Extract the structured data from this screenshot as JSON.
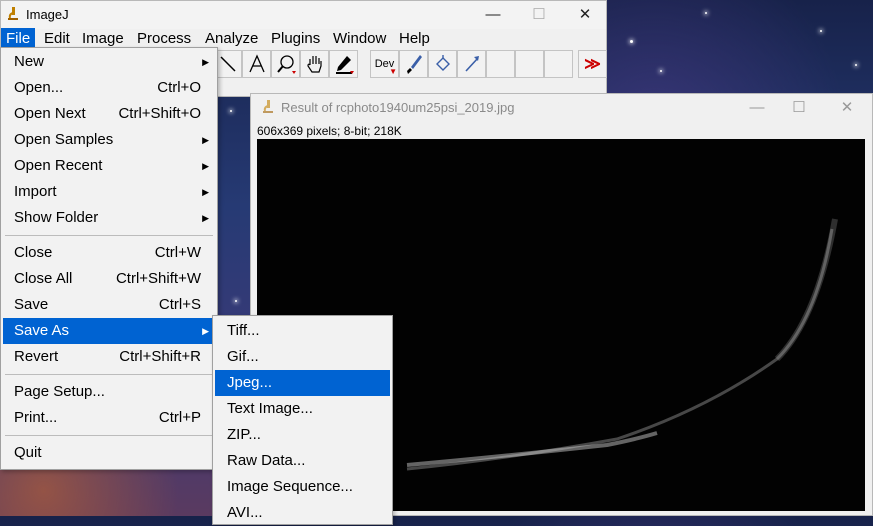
{
  "main_window": {
    "title": "ImageJ",
    "controls": {
      "minimize": "—",
      "maximize": "☐",
      "close": "✕"
    },
    "menubar": [
      "File",
      "Edit",
      "Image",
      "Process",
      "Analyze",
      "Plugins",
      "Window",
      "Help"
    ],
    "toolbar": {
      "tools": [
        "line-tool",
        "text-tool",
        "magnifier-tool",
        "hand-tool",
        "color-picker-tool",
        "dev",
        "brush-tool",
        "flood-fill-tool",
        "arrow-tool",
        "empty",
        "empty",
        "empty",
        "more-tools"
      ],
      "dev_label": "Dev",
      "more_label": "≫"
    }
  },
  "image_window": {
    "title": "Result of rcphoto1940um25psi_2019.jpg",
    "info": "606x369 pixels; 8-bit; 218K",
    "controls": {
      "minimize": "—",
      "maximize": "☐",
      "close": "✕"
    }
  },
  "file_menu": {
    "groups": [
      [
        {
          "label": "New",
          "shortcut": "",
          "submenu": true
        },
        {
          "label": "Open...",
          "shortcut": "Ctrl+O",
          "submenu": false
        },
        {
          "label": "Open Next",
          "shortcut": "Ctrl+Shift+O",
          "submenu": false
        },
        {
          "label": "Open Samples",
          "shortcut": "",
          "submenu": true
        },
        {
          "label": "Open Recent",
          "shortcut": "",
          "submenu": true
        },
        {
          "label": "Import",
          "shortcut": "",
          "submenu": true
        },
        {
          "label": "Show Folder",
          "shortcut": "",
          "submenu": true
        }
      ],
      [
        {
          "label": "Close",
          "shortcut": "Ctrl+W",
          "submenu": false
        },
        {
          "label": "Close All",
          "shortcut": "Ctrl+Shift+W",
          "submenu": false
        },
        {
          "label": "Save",
          "shortcut": "Ctrl+S",
          "submenu": false
        },
        {
          "label": "Save As",
          "shortcut": "",
          "submenu": true,
          "selected": true
        },
        {
          "label": "Revert",
          "shortcut": "Ctrl+Shift+R",
          "submenu": false
        }
      ],
      [
        {
          "label": "Page Setup...",
          "shortcut": "",
          "submenu": false
        },
        {
          "label": "Print...",
          "shortcut": "Ctrl+P",
          "submenu": false
        }
      ],
      [
        {
          "label": "Quit",
          "shortcut": "",
          "submenu": false
        }
      ]
    ]
  },
  "save_as_menu": {
    "items": [
      {
        "label": "Tiff..."
      },
      {
        "label": "Gif..."
      },
      {
        "label": "Jpeg...",
        "selected": true
      },
      {
        "label": "Text Image..."
      },
      {
        "label": "ZIP..."
      },
      {
        "label": "Raw Data..."
      },
      {
        "label": "Image Sequence..."
      },
      {
        "label": "AVI..."
      }
    ]
  },
  "colors": {
    "accent": "#0063d2",
    "menu_bg": "#f2f2f2"
  }
}
